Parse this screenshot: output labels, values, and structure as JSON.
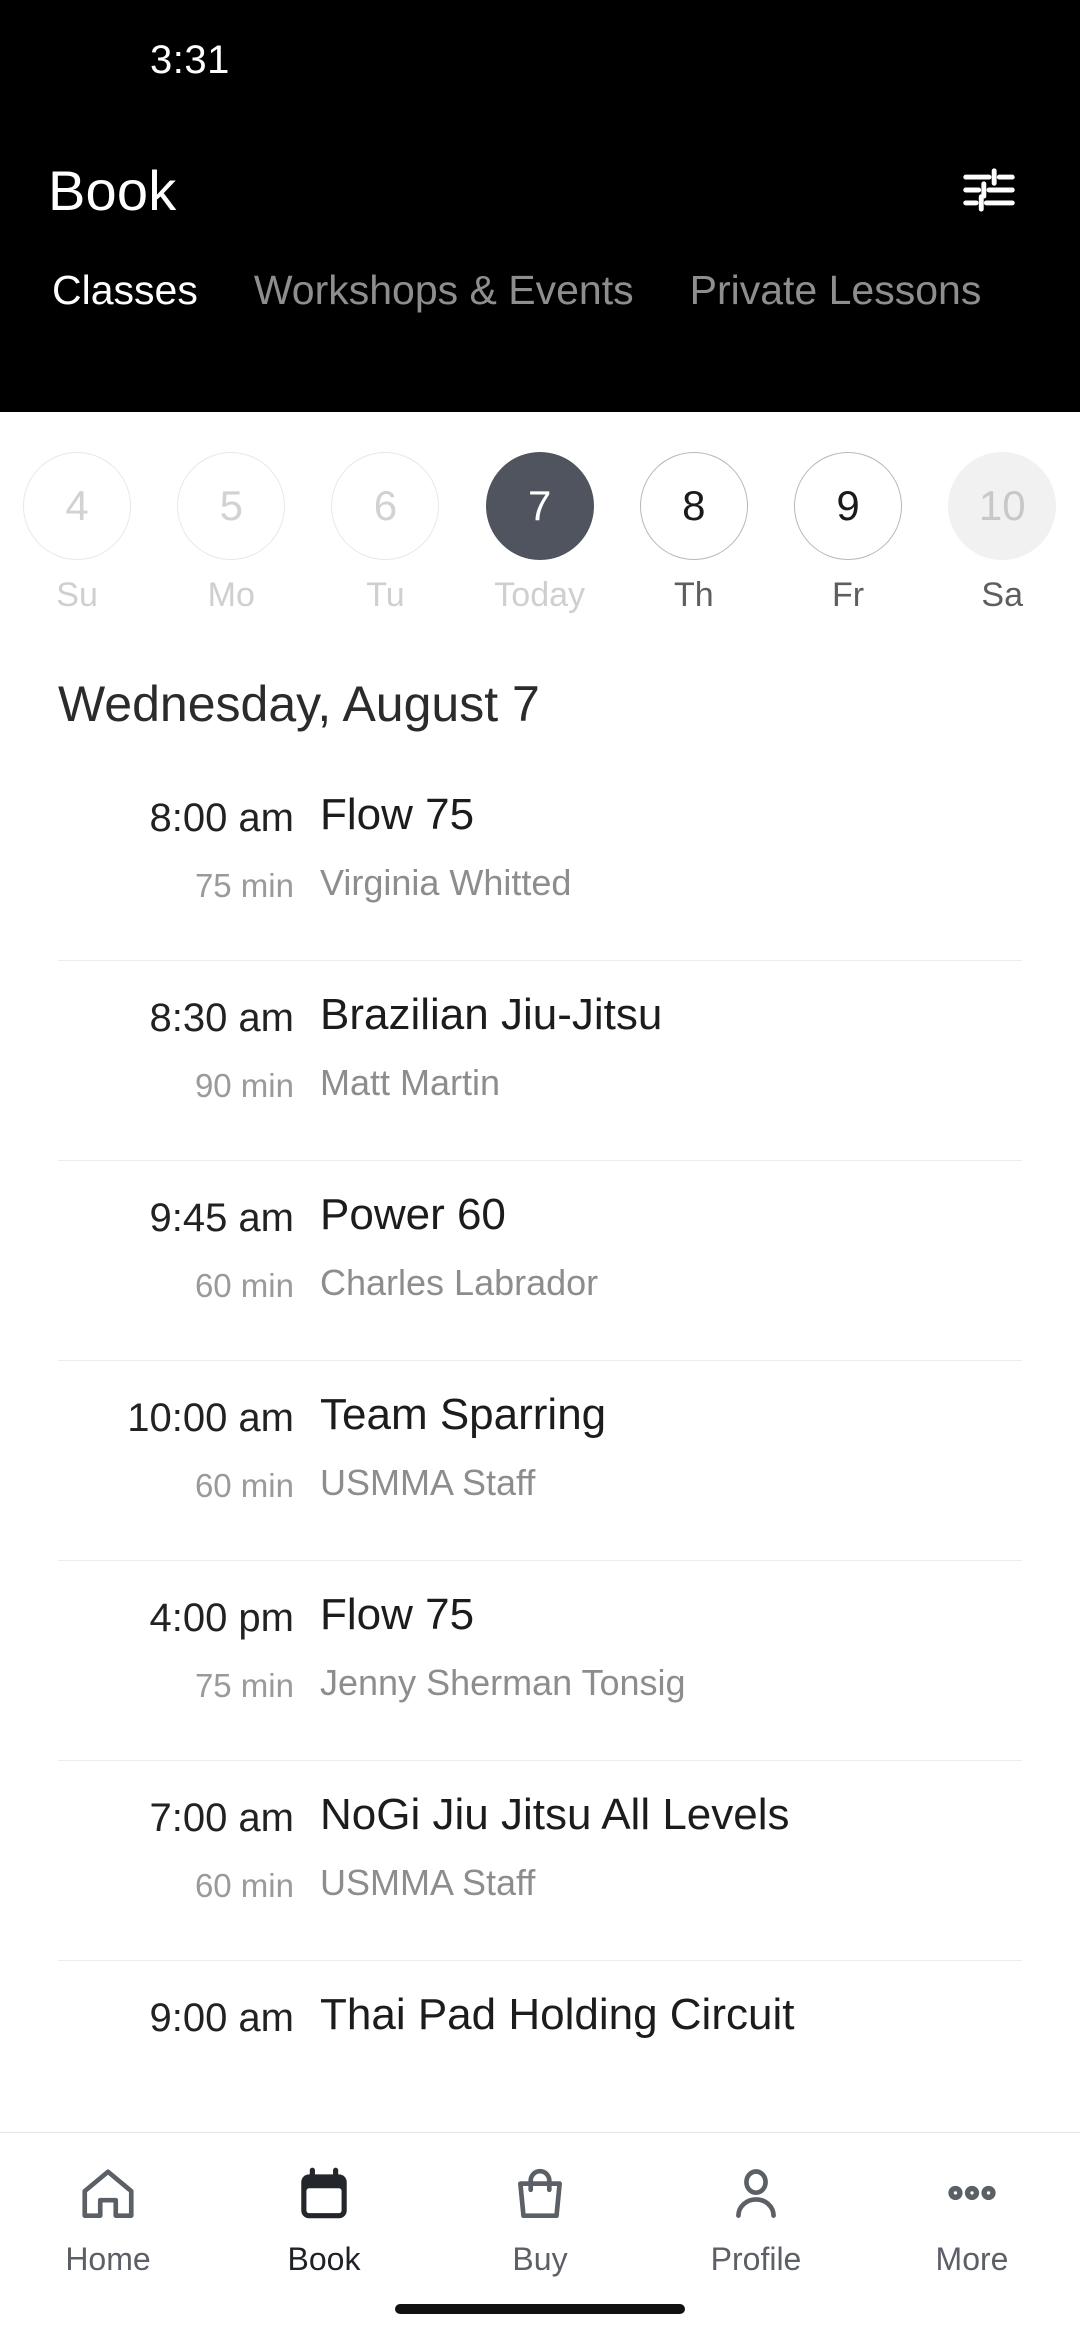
{
  "status": {
    "time": "3:31"
  },
  "header": {
    "title": "Book",
    "filter_icon": "sliders-filter-icon",
    "accent_dark": "#000000",
    "selected_day_color": "#4f545e"
  },
  "tabs": [
    {
      "label": "Classes",
      "active": true
    },
    {
      "label": "Workshops & Events",
      "active": false
    },
    {
      "label": "Private Lessons",
      "active": false
    }
  ],
  "date_strip": [
    {
      "day": "4",
      "weekday": "Su",
      "state": "disabled"
    },
    {
      "day": "5",
      "weekday": "Mo",
      "state": "disabled"
    },
    {
      "day": "6",
      "weekday": "Tu",
      "state": "disabled"
    },
    {
      "day": "7",
      "weekday": "Today",
      "state": "today"
    },
    {
      "day": "8",
      "weekday": "Th",
      "state": "enabled"
    },
    {
      "day": "9",
      "weekday": "Fr",
      "state": "enabled"
    },
    {
      "day": "10",
      "weekday": "Sa",
      "state": "weekend"
    }
  ],
  "date_heading": "Wednesday, August 7",
  "classes": [
    {
      "time": "8:00 am",
      "duration": "75 min",
      "name": "Flow 75",
      "instructor": "Virginia Whitted"
    },
    {
      "time": "8:30 am",
      "duration": "90 min",
      "name": "Brazilian Jiu-Jitsu",
      "instructor": "Matt Martin"
    },
    {
      "time": "9:45 am",
      "duration": "60 min",
      "name": "Power 60",
      "instructor": "Charles Labrador"
    },
    {
      "time": "10:00 am",
      "duration": "60 min",
      "name": "Team Sparring",
      "instructor": "USMMA Staff"
    },
    {
      "time": "4:00 pm",
      "duration": "75 min",
      "name": "Flow 75",
      "instructor": "Jenny Sherman Tonsig"
    },
    {
      "time": "7:00 am",
      "duration": "60 min",
      "name": "NoGi Jiu Jitsu All Levels",
      "instructor": "USMMA Staff"
    },
    {
      "time": "9:00 am",
      "duration": "",
      "name": "Thai Pad Holding Circuit",
      "instructor": ""
    }
  ],
  "bottom_nav": [
    {
      "label": "Home",
      "icon": "home-icon",
      "active": false
    },
    {
      "label": "Book",
      "icon": "calendar-icon",
      "active": true
    },
    {
      "label": "Buy",
      "icon": "bag-icon",
      "active": false
    },
    {
      "label": "Profile",
      "icon": "person-icon",
      "active": false
    },
    {
      "label": "More",
      "icon": "ellipsis-icon",
      "active": false
    }
  ]
}
